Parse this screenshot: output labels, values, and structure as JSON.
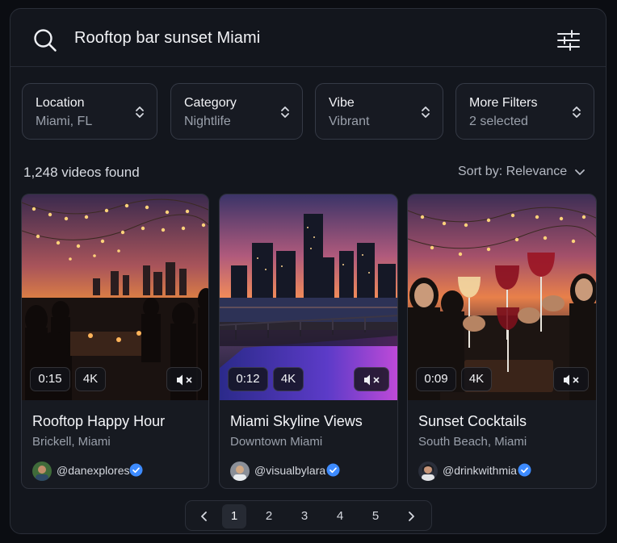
{
  "search": {
    "query": "Rooftop bar sunset Miami"
  },
  "filters": [
    {
      "label": "Location",
      "value": "Miami, FL"
    },
    {
      "label": "Category",
      "value": "Nightlife"
    },
    {
      "label": "Vibe",
      "value": "Vibrant"
    },
    {
      "label": "More Filters",
      "value": "2 selected"
    }
  ],
  "results": {
    "count_text": "1,248 videos found",
    "sort_text": "Sort by: Relevance"
  },
  "videos": [
    {
      "duration": "0:15",
      "quality": "4K",
      "title": "Rooftop Happy Hour",
      "location": "Brickell, Miami",
      "handle": "@danexplores"
    },
    {
      "duration": "0:12",
      "quality": "4K",
      "title": "Miami Skyline Views",
      "location": "Downtown Miami",
      "handle": "@visualbylara"
    },
    {
      "duration": "0:09",
      "quality": "4K",
      "title": "Sunset Cocktails",
      "location": "South Beach, Miami",
      "handle": "@drinkwithmia"
    }
  ],
  "pagination": {
    "pages": [
      "1",
      "2",
      "3",
      "4",
      "5"
    ],
    "current": "1"
  },
  "colors": {
    "background": "#0b0d12",
    "panel": "#13161d",
    "verified": "#3d8bff",
    "muted_text": "#9aa0ab"
  }
}
